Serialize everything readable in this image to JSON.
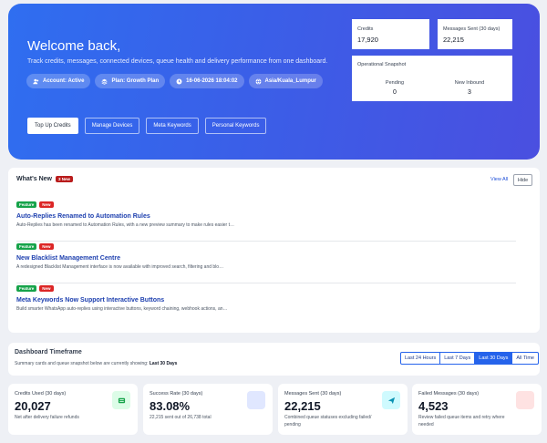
{
  "hero": {
    "title": "Welcome back,",
    "subtitle": "Track credits, messages, connected devices, queue health and delivery performance from one dashboard.",
    "pills": [
      {
        "icon": "users-icon",
        "label": "Account: Active"
      },
      {
        "icon": "layers-icon",
        "label": "Plan: Growth Plan"
      },
      {
        "icon": "clock-icon",
        "label": "16-06-2026 18:04:02"
      },
      {
        "icon": "globe-icon",
        "label": "Asia/Kuala_Lumpur"
      }
    ],
    "buttons": [
      {
        "label": "Top Up Credits"
      },
      {
        "label": "Manage Devices"
      },
      {
        "label": "Meta Keywords"
      },
      {
        "label": "Personal Keywords"
      }
    ],
    "credits": {
      "label": "Credits",
      "value": "17,920"
    },
    "messages": {
      "label": "Messages Sent (30 days)",
      "value": "22,215"
    },
    "snapshot": {
      "title": "Operational Snapshot",
      "pending_label": "Pending",
      "pending_value": "0",
      "inbound_label": "New Inbound",
      "inbound_value": "3"
    }
  },
  "whats_new": {
    "title": "What's New",
    "badge": "3 New",
    "view_all": "View All",
    "hide": "Hide",
    "items": [
      {
        "tag_feature": "Feature",
        "tag_new": "New",
        "title": "Auto-Replies Renamed to Automation Rules",
        "desc": "Auto-Replies has been renamed to Automation Rules, with a new preview summary to make rules easier t…"
      },
      {
        "tag_feature": "Feature",
        "tag_new": "New",
        "title": "New Blacklist Management Centre",
        "desc": "A redesigned Blacklist Management interface is now available with improved search, filtering and blo…"
      },
      {
        "tag_feature": "Feature",
        "tag_new": "New",
        "title": "Meta Keywords Now Support Interactive Buttons",
        "desc": "Build smarter WhatsApp auto-replies using interactive buttons, keyword chaining, webhook actions, an…"
      }
    ]
  },
  "timeframe": {
    "title": "Dashboard Timeframe",
    "subtitle_prefix": "Summary cards and queue snapshot below are currently showing:",
    "current": "Last 30 Days",
    "options": [
      "Last 24 Hours",
      "Last 7 Days",
      "Last 30 Days",
      "All Time"
    ]
  },
  "metrics": [
    {
      "label": "Credits Used (30 days)",
      "value": "20,027",
      "hint": "Net after delivery failure refunds",
      "icon": "money-icon",
      "color": "#16a34a",
      "bg": "#dcfce7"
    },
    {
      "label": "Success Rate (30 days)",
      "value": "83.08%",
      "hint": "22,215 sent out of 26,738 total",
      "icon": "check-icon",
      "color": "#2563eb",
      "bg": "#e0e7ff"
    },
    {
      "label": "Messages Sent (30 days)",
      "value": "22,215",
      "hint": "Combined queue statuses excluding failed/ pending",
      "icon": "send-icon",
      "color": "#0891b2",
      "bg": "#cffafe"
    },
    {
      "label": "Failed Messages (30 days)",
      "value": "4,523",
      "hint": "Review failed queue items and retry where needed",
      "icon": "warning-icon",
      "color": "#dc2626",
      "bg": "#fee2e2"
    }
  ]
}
